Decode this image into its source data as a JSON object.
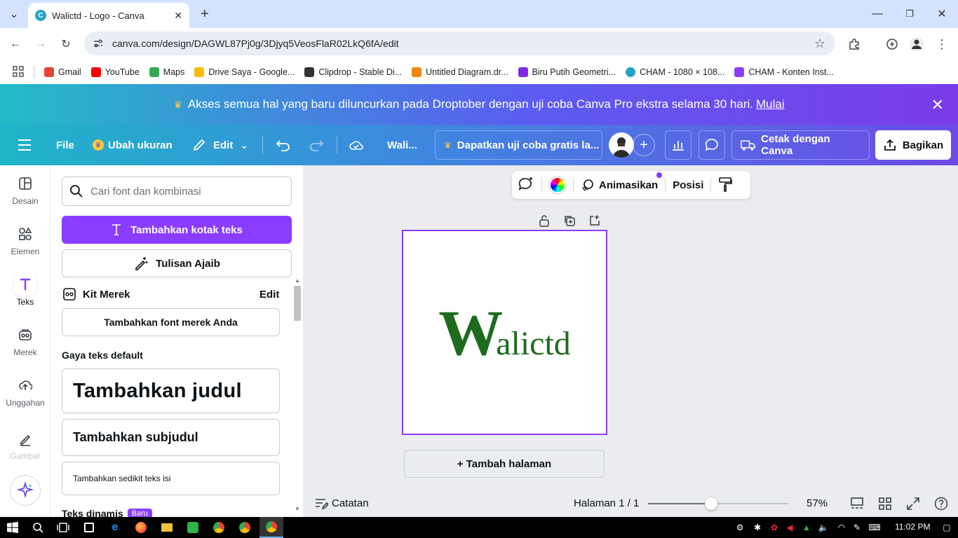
{
  "browser": {
    "tab_title": "Walictd - Logo - Canva",
    "url": "canva.com/design/DAGWL87Pj0g/3Djyq5VeosFlaR02LkQ6fA/edit",
    "bookmarks": [
      {
        "label": "Gmail",
        "color": "#ea4335"
      },
      {
        "label": "YouTube",
        "color": "#ff0000"
      },
      {
        "label": "Maps",
        "color": "#34a853"
      },
      {
        "label": "Drive Saya - Google...",
        "color": "#fbbc04"
      },
      {
        "label": "Clipdrop - Stable Di...",
        "color": "#333333"
      },
      {
        "label": "Untitled Diagram.dr...",
        "color": "#f08705"
      },
      {
        "label": "Biru Putih Geometri...",
        "color": "#7d2ae8"
      },
      {
        "label": "CHAM - 1080 × 108...",
        "color": "#23a3c9"
      },
      {
        "label": "CHAM - Konten Inst...",
        "color": "#8b3dff"
      }
    ]
  },
  "banner": {
    "text": "Akses semua hal yang baru diluncurkan pada Droptober dengan uji coba Canva Pro ekstra selama 30 hari.",
    "link": "Mulai"
  },
  "header": {
    "file": "File",
    "resize": "Ubah ukuran",
    "edit": "Edit",
    "doc_title": "Wali...",
    "trial": "Dapatkan uji coba gratis la...",
    "print": "Cetak dengan Canva",
    "share": "Bagikan"
  },
  "rail": [
    {
      "label": "Desain"
    },
    {
      "label": "Elemen"
    },
    {
      "label": "Teks"
    },
    {
      "label": "Merek"
    },
    {
      "label": "Unggahan"
    },
    {
      "label": "Gambar"
    }
  ],
  "panel": {
    "search_placeholder": "Cari font dan kombinasi",
    "add_textbox": "Tambahkan kotak teks",
    "magic_write": "Tulisan Ajaib",
    "brand_kit": "Kit Merek",
    "brand_edit": "Edit",
    "add_brand_font": "Tambahkan font merek Anda",
    "default_styles": "Gaya teks default",
    "heading": "Tambahkan judul",
    "subheading": "Tambahkan subjudul",
    "body": "Tambahkan sedikit teks isi",
    "dynamic": "Teks dinamis",
    "new_badge": "Baru"
  },
  "canvas": {
    "animate": "Animasikan",
    "position": "Posisi",
    "logo_big": "W",
    "logo_rest": "alictd",
    "add_page": "+ Tambah halaman"
  },
  "footer": {
    "notes": "Catatan",
    "page": "Halaman 1 / 1",
    "zoom": "57%",
    "zoom_level": 0.45
  },
  "taskbar": {
    "time": "11:02 PM"
  }
}
